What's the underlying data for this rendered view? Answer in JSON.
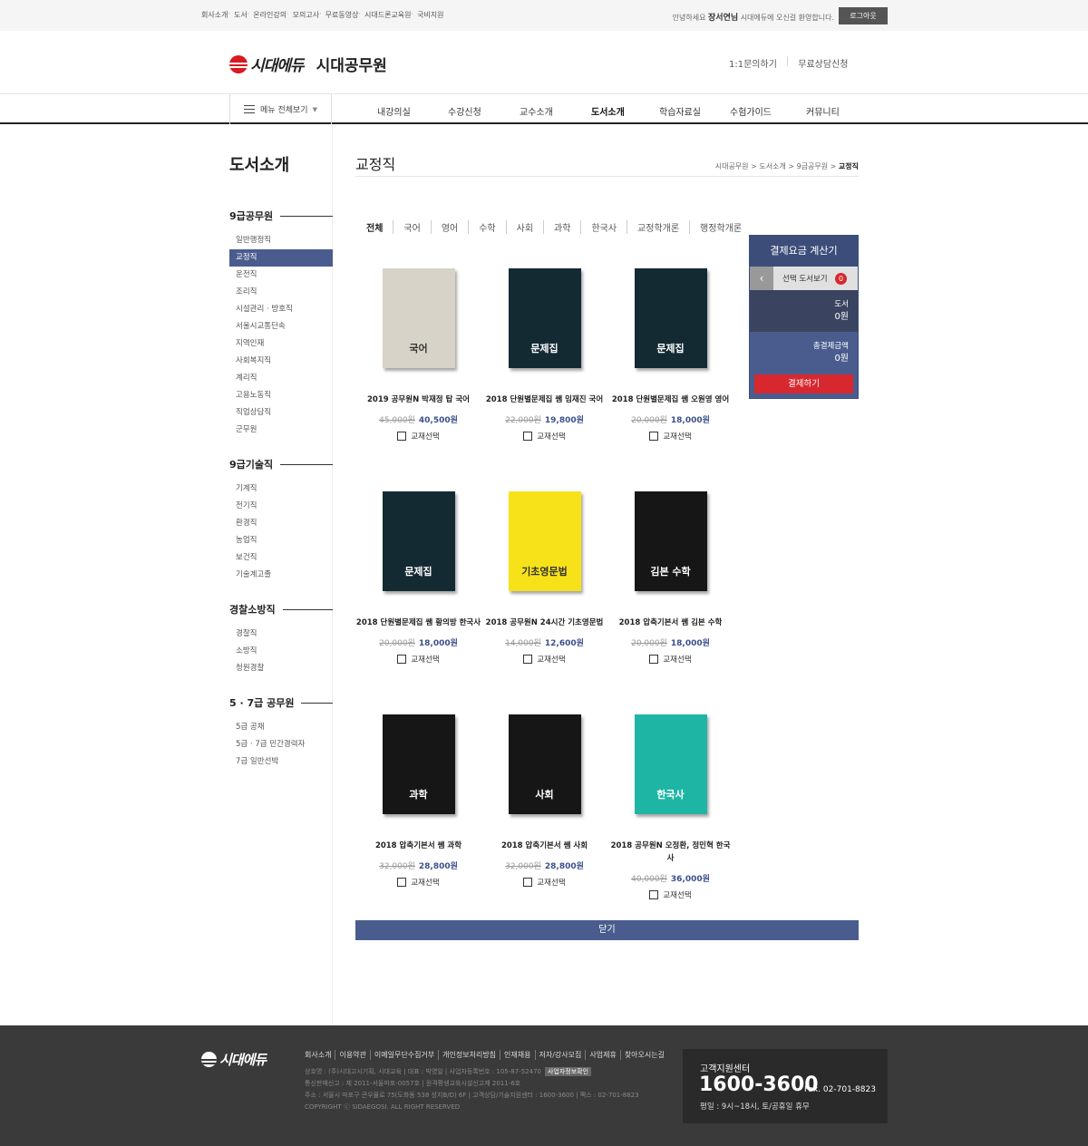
{
  "topbar": {
    "links": [
      "회사소개",
      "도서",
      "온라인강의",
      "모의고사",
      "무료동영상",
      "시대드론교육원",
      "국비지원"
    ],
    "greeting_pre": "안녕하세요",
    "user_name": "장서연님",
    "greeting_post": "시대에듀에 오신걸 환영합니다.",
    "logout_label": "로그아웃"
  },
  "header": {
    "logo": "시대에듀",
    "site_name": "시대공무원",
    "links": [
      "1:1문의하기",
      "무료상담신청"
    ]
  },
  "gnb": {
    "all_menu_label": "메뉴 전체보기",
    "items": [
      "내강의실",
      "수강신청",
      "교수소개",
      "도서소개",
      "학습자료실",
      "수험가이드",
      "커뮤니티"
    ],
    "active_index": 3
  },
  "lnb": {
    "title": "도서소개",
    "sections": [
      {
        "title": "9급공무원",
        "items": [
          "일반행정직",
          "교정직",
          "운전직",
          "조리직",
          "시설관리 · 방호직",
          "서울시교통단속",
          "지역인재",
          "사회복지직",
          "계리직",
          "고용노동직",
          "직업상담직",
          "군무원"
        ],
        "active_index": 1
      },
      {
        "title": "9급기술직",
        "items": [
          "기계직",
          "전기직",
          "환경직",
          "농업직",
          "보건직",
          "기술계고졸"
        ]
      },
      {
        "title": "경찰소방직",
        "items": [
          "경찰직",
          "소방직",
          "청원경찰"
        ]
      },
      {
        "title": "5 · 7급 공무원",
        "items": [
          "5급 공채",
          "5급 · 7급 민간경력자",
          "7급 일반선박"
        ]
      }
    ]
  },
  "content": {
    "page_title": "교정직",
    "breadcrumb": [
      "시대공무원",
      "도서소개",
      "9급공무원",
      "교정직"
    ],
    "tabs": [
      "전체",
      "국어",
      "영어",
      "수학",
      "사회",
      "과학",
      "한국사",
      "교정학개론",
      "행정학개론"
    ],
    "select_label": "교재선택",
    "close_label": "닫기"
  },
  "books": [
    {
      "title": "2019 공무원N 박재정 탑 국어",
      "old_price": "45,000원",
      "new_price": "40,500원",
      "cover_text": "국어",
      "cover_color": "#d8d3c8"
    },
    {
      "title": "2018 단원별문제집 쌤 임재진 국어",
      "old_price": "22,000원",
      "new_price": "19,800원",
      "cover_text": "문제집",
      "cover_color": "#132a33"
    },
    {
      "title": "2018 단원별문제집 쌤 오원영 영어",
      "old_price": "20,000원",
      "new_price": "18,000원",
      "cover_text": "문제집",
      "cover_color": "#132a33"
    },
    {
      "title": "2018 단원별문제집 쌤 황의방 한국사",
      "old_price": "20,000원",
      "new_price": "18,000원",
      "cover_text": "문제집",
      "cover_color": "#132a33"
    },
    {
      "title": "2018 공무원N 24시간 기초영문법",
      "old_price": "14,000원",
      "new_price": "12,600원",
      "cover_text": "기초영문법",
      "cover_color": "#f7e21a"
    },
    {
      "title": "2018 압축기본서 쌤 김본 수학",
      "old_price": "20,000원",
      "new_price": "18,000원",
      "cover_text": "김본 수학",
      "cover_color": "#161616"
    },
    {
      "title": "2018 압축기본서 쌤 과학",
      "old_price": "32,000원",
      "new_price": "28,800원",
      "cover_text": "과학",
      "cover_color": "#161616"
    },
    {
      "title": "2018 압축기본서 쌤 사회",
      "old_price": "32,000원",
      "new_price": "28,800원",
      "cover_text": "사회",
      "cover_color": "#161616"
    },
    {
      "title": "2018 공무원N 오정환, 정민혁 한국사",
      "old_price": "40,000원",
      "new_price": "36,000원",
      "cover_text": "한국사",
      "cover_color": "#1fb5a5"
    }
  ],
  "calculator": {
    "title": "결제요금 계산기",
    "selected_label": "선택 도서보기",
    "selected_count": "0",
    "books_label": "도서",
    "books_value": "0원",
    "total_label": "총결제금액",
    "total_value": "0원",
    "pay_label": "결제하기"
  },
  "footer": {
    "logo": "시대에듀",
    "links": [
      "회사소개",
      "이용약관",
      "이메일무단수집거부",
      "개인정보처리방침",
      "인재채용",
      "저자/강사모집",
      "사업제휴",
      "찾아오시는길"
    ],
    "info1": "상호명 : (주)시대고시기획, 시대교육 | 대표 : 박영일 | 사업자등록번호 : 105-87-52470",
    "info1_tag": "사업자정보확인",
    "info2": "통신판매신고 : 제 2011-서울마포-0057호 | 원격평생교육시설신고제 2011-6호",
    "info3": "주소 : 서울시 마포구 큰우물로 75(도화동 538 성지B/D) 6F | 고객상담/기술지원센터 : 1600-3600 | 팩스 : 02-701-8823",
    "copyright": "COPYRIGHT ⓒ SIDAEGOSI. ALL RIGHT RESERVED",
    "cs_title": "고객지원센터",
    "cs_number": "1600-3600",
    "cs_fax": "Fax. 02-701-8823",
    "cs_hours": "평일 : 9시~18시, 토/공휴일 휴무"
  },
  "colors": {
    "accent": "#4a5c8e",
    "brand_red": "#d71921",
    "pay_red": "#d7282f"
  }
}
